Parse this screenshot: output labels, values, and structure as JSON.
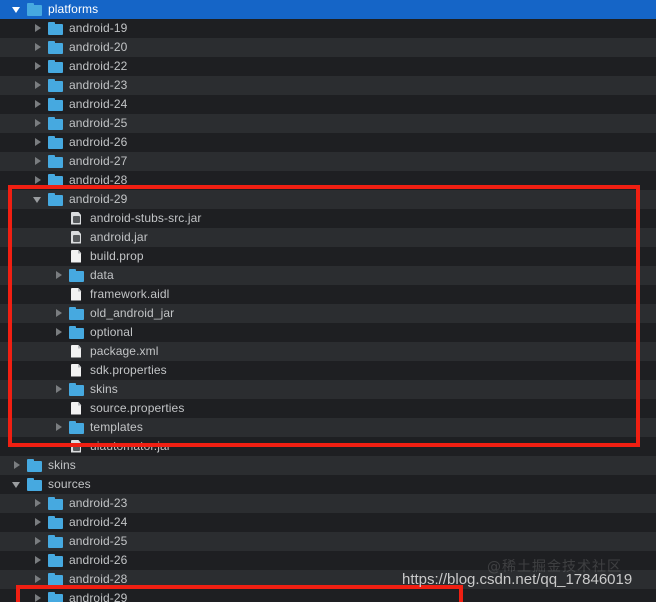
{
  "window": {
    "title": "platforms",
    "background_color": "#1e1f22",
    "selection_color": "#1565c7",
    "row_alt_color": "#2b2d30",
    "annotation_color": "#f01f12",
    "folder_icon_color": "#46a9e0"
  },
  "tree": {
    "rows": [
      {
        "label": "platforms",
        "depth": 0,
        "icon": "folder-icon",
        "arrow": "chevron-down-icon",
        "selected": true,
        "stripe": "even"
      },
      {
        "label": "android-19",
        "depth": 1,
        "icon": "folder-icon",
        "arrow": "chevron-right-icon",
        "selected": false,
        "stripe": "odd"
      },
      {
        "label": "android-20",
        "depth": 1,
        "icon": "folder-icon",
        "arrow": "chevron-right-icon",
        "selected": false,
        "stripe": "even"
      },
      {
        "label": "android-22",
        "depth": 1,
        "icon": "folder-icon",
        "arrow": "chevron-right-icon",
        "selected": false,
        "stripe": "odd"
      },
      {
        "label": "android-23",
        "depth": 1,
        "icon": "folder-icon",
        "arrow": "chevron-right-icon",
        "selected": false,
        "stripe": "even"
      },
      {
        "label": "android-24",
        "depth": 1,
        "icon": "folder-icon",
        "arrow": "chevron-right-icon",
        "selected": false,
        "stripe": "odd"
      },
      {
        "label": "android-25",
        "depth": 1,
        "icon": "folder-icon",
        "arrow": "chevron-right-icon",
        "selected": false,
        "stripe": "even"
      },
      {
        "label": "android-26",
        "depth": 1,
        "icon": "folder-icon",
        "arrow": "chevron-right-icon",
        "selected": false,
        "stripe": "odd"
      },
      {
        "label": "android-27",
        "depth": 1,
        "icon": "folder-icon",
        "arrow": "chevron-right-icon",
        "selected": false,
        "stripe": "even"
      },
      {
        "label": "android-28",
        "depth": 1,
        "icon": "folder-icon",
        "arrow": "chevron-right-icon",
        "selected": false,
        "stripe": "odd"
      },
      {
        "label": "android-29",
        "depth": 1,
        "icon": "folder-icon",
        "arrow": "chevron-down-icon",
        "selected": false,
        "stripe": "even"
      },
      {
        "label": "android-stubs-src.jar",
        "depth": 2,
        "icon": "jar-icon",
        "arrow": "none",
        "selected": false,
        "stripe": "odd"
      },
      {
        "label": "android.jar",
        "depth": 2,
        "icon": "jar-icon",
        "arrow": "none",
        "selected": false,
        "stripe": "even"
      },
      {
        "label": "build.prop",
        "depth": 2,
        "icon": "file-icon",
        "arrow": "none",
        "selected": false,
        "stripe": "odd"
      },
      {
        "label": "data",
        "depth": 2,
        "icon": "folder-icon",
        "arrow": "chevron-right-icon",
        "selected": false,
        "stripe": "even"
      },
      {
        "label": "framework.aidl",
        "depth": 2,
        "icon": "file-icon",
        "arrow": "none",
        "selected": false,
        "stripe": "odd"
      },
      {
        "label": "old_android_jar",
        "depth": 2,
        "icon": "folder-icon",
        "arrow": "chevron-right-icon",
        "selected": false,
        "stripe": "even"
      },
      {
        "label": "optional",
        "depth": 2,
        "icon": "folder-icon",
        "arrow": "chevron-right-icon",
        "selected": false,
        "stripe": "odd"
      },
      {
        "label": "package.xml",
        "depth": 2,
        "icon": "file-icon",
        "arrow": "none",
        "selected": false,
        "stripe": "even"
      },
      {
        "label": "sdk.properties",
        "depth": 2,
        "icon": "file-icon",
        "arrow": "none",
        "selected": false,
        "stripe": "odd"
      },
      {
        "label": "skins",
        "depth": 2,
        "icon": "folder-icon",
        "arrow": "chevron-right-icon",
        "selected": false,
        "stripe": "even"
      },
      {
        "label": "source.properties",
        "depth": 2,
        "icon": "file-icon",
        "arrow": "none",
        "selected": false,
        "stripe": "odd"
      },
      {
        "label": "templates",
        "depth": 2,
        "icon": "folder-icon",
        "arrow": "chevron-right-icon",
        "selected": false,
        "stripe": "even"
      },
      {
        "label": "uiautomator.jar",
        "depth": 2,
        "icon": "jar-icon",
        "arrow": "none",
        "selected": false,
        "stripe": "odd"
      },
      {
        "label": "skins",
        "depth": 0,
        "icon": "folder-icon",
        "arrow": "chevron-right-icon",
        "selected": false,
        "stripe": "even"
      },
      {
        "label": "sources",
        "depth": 0,
        "icon": "folder-icon",
        "arrow": "chevron-down-icon",
        "selected": false,
        "stripe": "odd"
      },
      {
        "label": "android-23",
        "depth": 1,
        "icon": "folder-icon",
        "arrow": "chevron-right-icon",
        "selected": false,
        "stripe": "even"
      },
      {
        "label": "android-24",
        "depth": 1,
        "icon": "folder-icon",
        "arrow": "chevron-right-icon",
        "selected": false,
        "stripe": "odd"
      },
      {
        "label": "android-25",
        "depth": 1,
        "icon": "folder-icon",
        "arrow": "chevron-right-icon",
        "selected": false,
        "stripe": "even"
      },
      {
        "label": "android-26",
        "depth": 1,
        "icon": "folder-icon",
        "arrow": "chevron-right-icon",
        "selected": false,
        "stripe": "odd"
      },
      {
        "label": "android-28",
        "depth": 1,
        "icon": "folder-icon",
        "arrow": "chevron-right-icon",
        "selected": false,
        "stripe": "even"
      },
      {
        "label": "android-29",
        "depth": 1,
        "icon": "folder-icon",
        "arrow": "chevron-right-icon",
        "selected": false,
        "stripe": "odd"
      }
    ]
  },
  "annotations": [
    {
      "name": "android-29-platform-contents-highlight"
    },
    {
      "name": "android-29-sources-highlight"
    }
  ],
  "watermarks": {
    "url": "https://blog.csdn.net/qq_17846019",
    "community": "@稀土掘金技术社区"
  }
}
